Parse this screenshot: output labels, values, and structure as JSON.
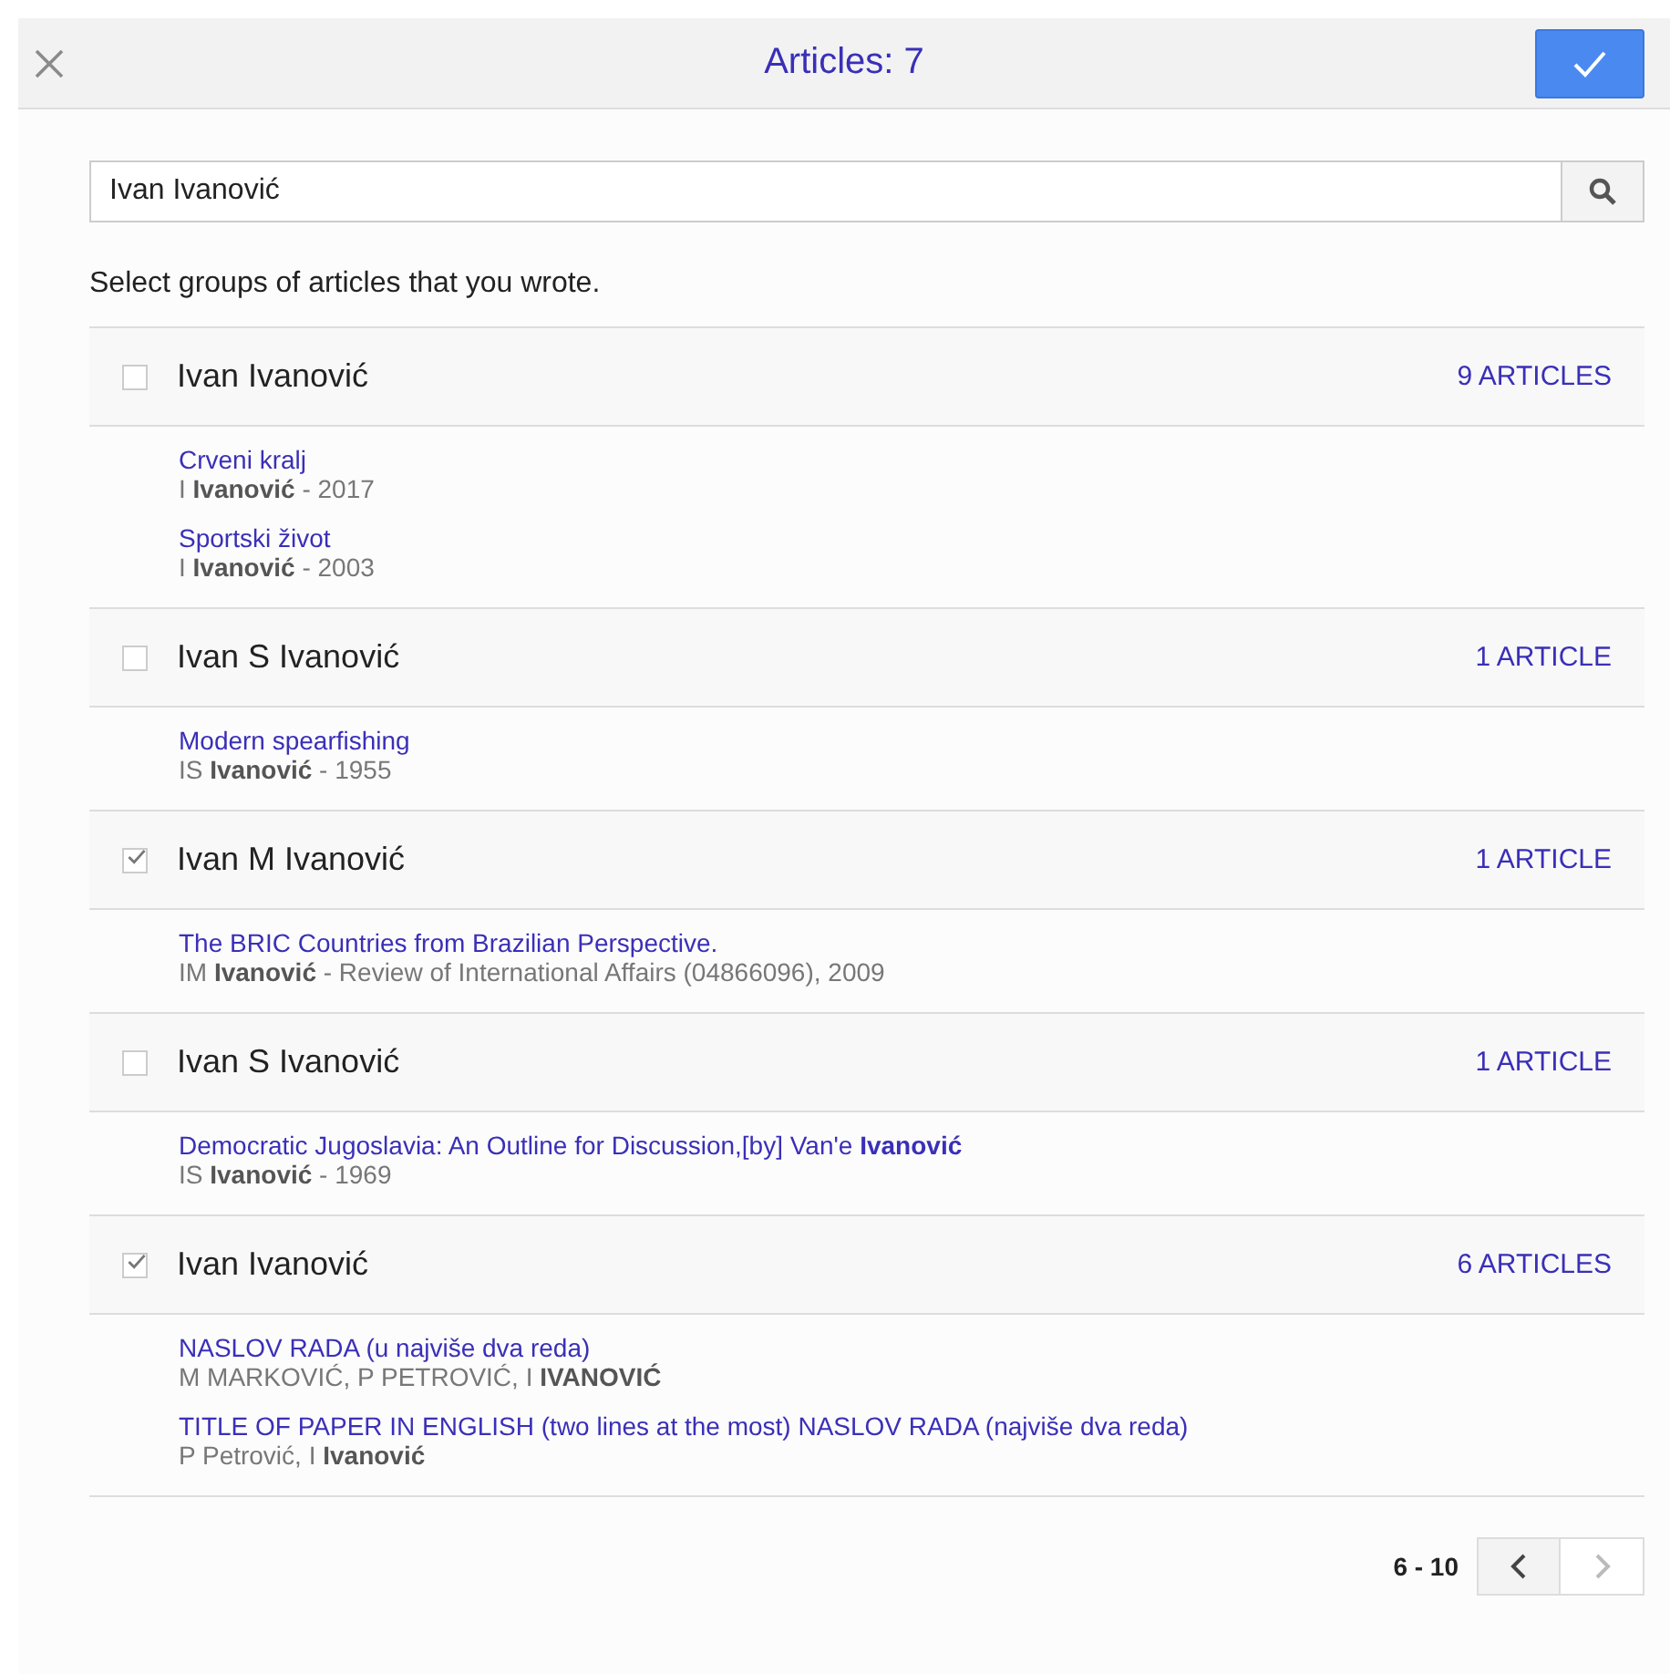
{
  "header": {
    "title": "Articles: 7"
  },
  "search": {
    "value": "Ivan Ivanović"
  },
  "instructions": "Select groups of articles that you wrote.",
  "groups": [
    {
      "name": "Ivan Ivanović",
      "checked": false,
      "count": "9 ARTICLES",
      "articles": [
        {
          "title": "Crveni kralj",
          "byline": "I **Ivanović** - 2017"
        },
        {
          "title": "Sportski život",
          "byline": "I **Ivanović** - 2003"
        }
      ]
    },
    {
      "name": "Ivan S Ivanović",
      "checked": false,
      "count": "1 ARTICLE",
      "articles": [
        {
          "title": "Modern spearfishing",
          "byline": "IS **Ivanović** - 1955"
        }
      ]
    },
    {
      "name": "Ivan M Ivanović",
      "checked": true,
      "count": "1 ARTICLE",
      "articles": [
        {
          "title": "The BRIC Countries from Brazilian Perspective.",
          "byline": "IM **Ivanović** - Review of International Affairs (04866096), 2009"
        }
      ]
    },
    {
      "name": "Ivan S Ivanović",
      "checked": false,
      "count": "1 ARTICLE",
      "articles": [
        {
          "title": "Democratic Jugoslavia: An Outline for Discussion,[by] Van'e **Ivanović**",
          "byline": "IS **Ivanović** - 1969"
        }
      ]
    },
    {
      "name": "Ivan Ivanović",
      "checked": true,
      "count": "6 ARTICLES",
      "articles": [
        {
          "title": "NASLOV RADA (u najviše dva reda)",
          "byline": "M MARKOVIĆ, P PETROVIĆ, I **IVANOVIĆ**"
        },
        {
          "title": "TITLE OF PAPER IN ENGLISH (two lines at the most) NASLOV RADA (najviše dva reda)",
          "byline": "P Petrović, I **Ivanović**"
        }
      ]
    }
  ],
  "pagination": {
    "range": "6 - 10",
    "prev_disabled": false,
    "next_disabled": true
  }
}
